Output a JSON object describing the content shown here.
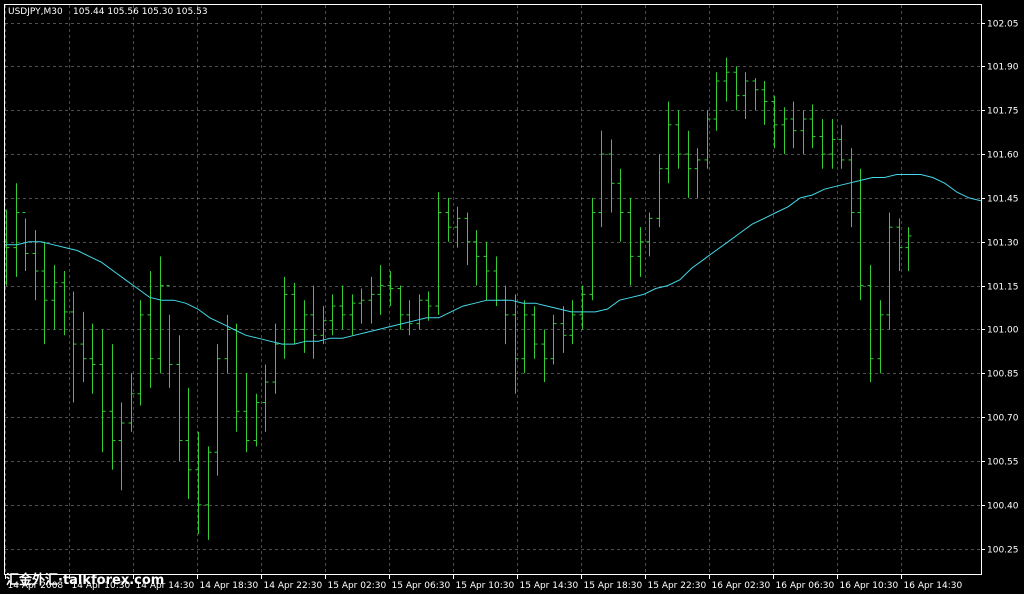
{
  "header": {
    "symbol_timeframe": "USDJPY,M30",
    "ohlc": "105.44 105.56 105.30 105.53"
  },
  "watermark": "汇金外汇·talkforex.com",
  "colors": {
    "background": "#000000",
    "bars": "#33cc33",
    "moving_average": "#44d8e8",
    "grid": "#c0c0c0",
    "axis_text": "#ffffff"
  },
  "chart_data": {
    "type": "ohlc",
    "ylim": [
      100.16,
      102.11
    ],
    "y_ticks": [
      102.05,
      101.9,
      101.75,
      101.6,
      101.45,
      101.3,
      101.15,
      101.0,
      100.85,
      100.7,
      100.55,
      100.4,
      100.25
    ],
    "y_tick_labels": [
      "102.05",
      "101.90",
      "101.75",
      "101.60",
      "101.45",
      "101.30",
      "101.15",
      "101.00",
      "100.85",
      "100.70",
      "100.55",
      "100.40",
      "100.25"
    ],
    "x_tick_labels": [
      "14 Apr 2008",
      "14 Apr 10:30",
      "14 Apr 14:30",
      "14 Apr 18:30",
      "14 Apr 22:30",
      "15 Apr 02:30",
      "15 Apr 06:30",
      "15 Apr 10:30",
      "15 Apr 14:30",
      "15 Apr 18:30",
      "15 Apr 22:30",
      "16 Apr 02:30",
      "16 Apr 06:30",
      "16 Apr 10:30",
      "16 Apr 14:30"
    ],
    "grid": true,
    "bars": [
      [
        101.3,
        101.41,
        101.15,
        101.28
      ],
      [
        101.28,
        101.5,
        101.18,
        101.4
      ],
      [
        101.4,
        101.38,
        101.2,
        101.26
      ],
      [
        101.26,
        101.34,
        101.1,
        101.2
      ],
      [
        101.2,
        101.3,
        100.95,
        101.1
      ],
      [
        101.1,
        101.22,
        101.0,
        101.16
      ],
      [
        101.16,
        101.2,
        100.98,
        101.06
      ],
      [
        101.06,
        101.13,
        100.75,
        100.95
      ],
      [
        100.95,
        101.06,
        100.82,
        100.9
      ],
      [
        100.9,
        101.02,
        100.78,
        100.88
      ],
      [
        100.88,
        101.0,
        100.58,
        100.72
      ],
      [
        100.72,
        100.95,
        100.52,
        100.62
      ],
      [
        100.62,
        100.75,
        100.45,
        100.68
      ],
      [
        100.68,
        100.85,
        100.65,
        100.78
      ],
      [
        100.78,
        101.1,
        100.74,
        101.05
      ],
      [
        101.05,
        101.2,
        100.8,
        100.9
      ],
      [
        100.9,
        101.25,
        100.85,
        101.15
      ],
      [
        101.15,
        101.05,
        100.8,
        100.88
      ],
      [
        100.88,
        100.98,
        100.55,
        100.62
      ],
      [
        100.62,
        100.8,
        100.42,
        100.52
      ],
      [
        100.52,
        100.65,
        100.3,
        100.4
      ],
      [
        100.4,
        100.6,
        100.28,
        100.58
      ],
      [
        100.58,
        100.95,
        100.5,
        100.9
      ],
      [
        100.9,
        101.05,
        100.85,
        101.0
      ],
      [
        101.0,
        101.02,
        100.65,
        100.72
      ],
      [
        100.72,
        100.85,
        100.58,
        100.62
      ],
      [
        100.62,
        100.78,
        100.6,
        100.75
      ],
      [
        100.75,
        100.88,
        100.65,
        100.82
      ],
      [
        100.82,
        101.02,
        100.78,
        100.95
      ],
      [
        100.95,
        101.18,
        100.9,
        101.12
      ],
      [
        101.12,
        101.16,
        100.95,
        101.0
      ],
      [
        101.0,
        101.1,
        100.92,
        101.05
      ],
      [
        101.05,
        101.15,
        100.9,
        100.98
      ],
      [
        100.98,
        101.08,
        100.95,
        101.03
      ],
      [
        101.03,
        101.12,
        100.98,
        101.08
      ],
      [
        101.08,
        101.15,
        101.0,
        101.05
      ],
      [
        101.05,
        101.12,
        100.98,
        101.09
      ],
      [
        101.09,
        101.14,
        101.02,
        101.1
      ],
      [
        101.1,
        101.18,
        101.02,
        101.12
      ],
      [
        101.12,
        101.22,
        101.05,
        101.15
      ],
      [
        101.15,
        101.2,
        101.08,
        101.14
      ],
      [
        101.14,
        101.15,
        101.0,
        101.05
      ],
      [
        101.05,
        101.1,
        100.98,
        101.02
      ],
      [
        101.02,
        101.12,
        101.0,
        101.1
      ],
      [
        101.1,
        101.13,
        101.03,
        101.08
      ],
      [
        101.08,
        101.47,
        101.05,
        101.4
      ],
      [
        101.4,
        101.45,
        101.3,
        101.35
      ],
      [
        101.35,
        101.42,
        101.28,
        101.38
      ],
      [
        101.38,
        101.4,
        101.22,
        101.3
      ],
      [
        101.3,
        101.34,
        101.15,
        101.25
      ],
      [
        101.25,
        101.3,
        101.1,
        101.2
      ],
      [
        101.2,
        101.25,
        101.08,
        101.1
      ],
      [
        101.1,
        101.15,
        100.95,
        101.05
      ],
      [
        101.05,
        101.12,
        100.78,
        100.9
      ],
      [
        100.9,
        101.1,
        100.85,
        101.05
      ],
      [
        101.05,
        101.08,
        100.9,
        100.95
      ],
      [
        100.95,
        101.0,
        100.82,
        100.9
      ],
      [
        100.9,
        101.05,
        100.88,
        101.02
      ],
      [
        101.02,
        101.08,
        100.92,
        100.98
      ],
      [
        100.98,
        101.1,
        100.95,
        101.05
      ],
      [
        101.05,
        101.15,
        101.0,
        101.12
      ],
      [
        101.12,
        101.45,
        101.1,
        101.4
      ],
      [
        101.4,
        101.68,
        101.35,
        101.6
      ],
      [
        101.6,
        101.65,
        101.4,
        101.5
      ],
      [
        101.5,
        101.55,
        101.3,
        101.4
      ],
      [
        101.4,
        101.45,
        101.15,
        101.25
      ],
      [
        101.25,
        101.35,
        101.18,
        101.3
      ],
      [
        101.3,
        101.4,
        101.25,
        101.38
      ],
      [
        101.38,
        101.6,
        101.35,
        101.55
      ],
      [
        101.55,
        101.78,
        101.5,
        101.7
      ],
      [
        101.7,
        101.75,
        101.55,
        101.6
      ],
      [
        101.6,
        101.68,
        101.45,
        101.55
      ],
      [
        101.55,
        101.62,
        101.45,
        101.58
      ],
      [
        101.58,
        101.75,
        101.55,
        101.72
      ],
      [
        101.72,
        101.88,
        101.68,
        101.85
      ],
      [
        101.85,
        101.93,
        101.78,
        101.88
      ],
      [
        101.88,
        101.9,
        101.75,
        101.8
      ],
      [
        101.8,
        101.88,
        101.72,
        101.85
      ],
      [
        101.85,
        101.86,
        101.75,
        101.82
      ],
      [
        101.82,
        101.85,
        101.7,
        101.78
      ],
      [
        101.78,
        101.8,
        101.62,
        101.7
      ],
      [
        101.7,
        101.76,
        101.6,
        101.72
      ],
      [
        101.72,
        101.78,
        101.62,
        101.68
      ],
      [
        101.68,
        101.75,
        101.6,
        101.72
      ],
      [
        101.72,
        101.77,
        101.62,
        101.66
      ],
      [
        101.66,
        101.72,
        101.55,
        101.6
      ],
      [
        101.6,
        101.72,
        101.55,
        101.65
      ],
      [
        101.65,
        101.7,
        101.55,
        101.58
      ],
      [
        101.58,
        101.62,
        101.35,
        101.4
      ],
      [
        101.4,
        101.55,
        101.1,
        101.15
      ],
      [
        101.15,
        101.22,
        100.82,
        100.9
      ],
      [
        100.9,
        101.1,
        100.85,
        101.05
      ],
      [
        101.05,
        101.4,
        101.0,
        101.35
      ],
      [
        101.35,
        101.38,
        101.2,
        101.28
      ],
      [
        101.28,
        101.35,
        101.2,
        101.32
      ]
    ],
    "moving_average": [
      101.29,
      101.29,
      101.3,
      101.3,
      101.29,
      101.28,
      101.27,
      101.25,
      101.23,
      101.2,
      101.17,
      101.14,
      101.11,
      101.1,
      101.1,
      101.09,
      101.07,
      101.04,
      101.02,
      101.0,
      100.98,
      100.97,
      100.96,
      100.95,
      100.95,
      100.96,
      100.96,
      100.97,
      100.97,
      100.98,
      100.99,
      101.0,
      101.01,
      101.02,
      101.03,
      101.04,
      101.04,
      101.06,
      101.08,
      101.09,
      101.1,
      101.1,
      101.1,
      101.09,
      101.09,
      101.08,
      101.07,
      101.06,
      101.06,
      101.06,
      101.07,
      101.1,
      101.11,
      101.12,
      101.14,
      101.15,
      101.17,
      101.21,
      101.24,
      101.27,
      101.3,
      101.33,
      101.36,
      101.38,
      101.4,
      101.42,
      101.45,
      101.46,
      101.48,
      101.49,
      101.5,
      101.51,
      101.52,
      101.52,
      101.53,
      101.53,
      101.53,
      101.52,
      101.5,
      101.47,
      101.45,
      101.44
    ]
  }
}
